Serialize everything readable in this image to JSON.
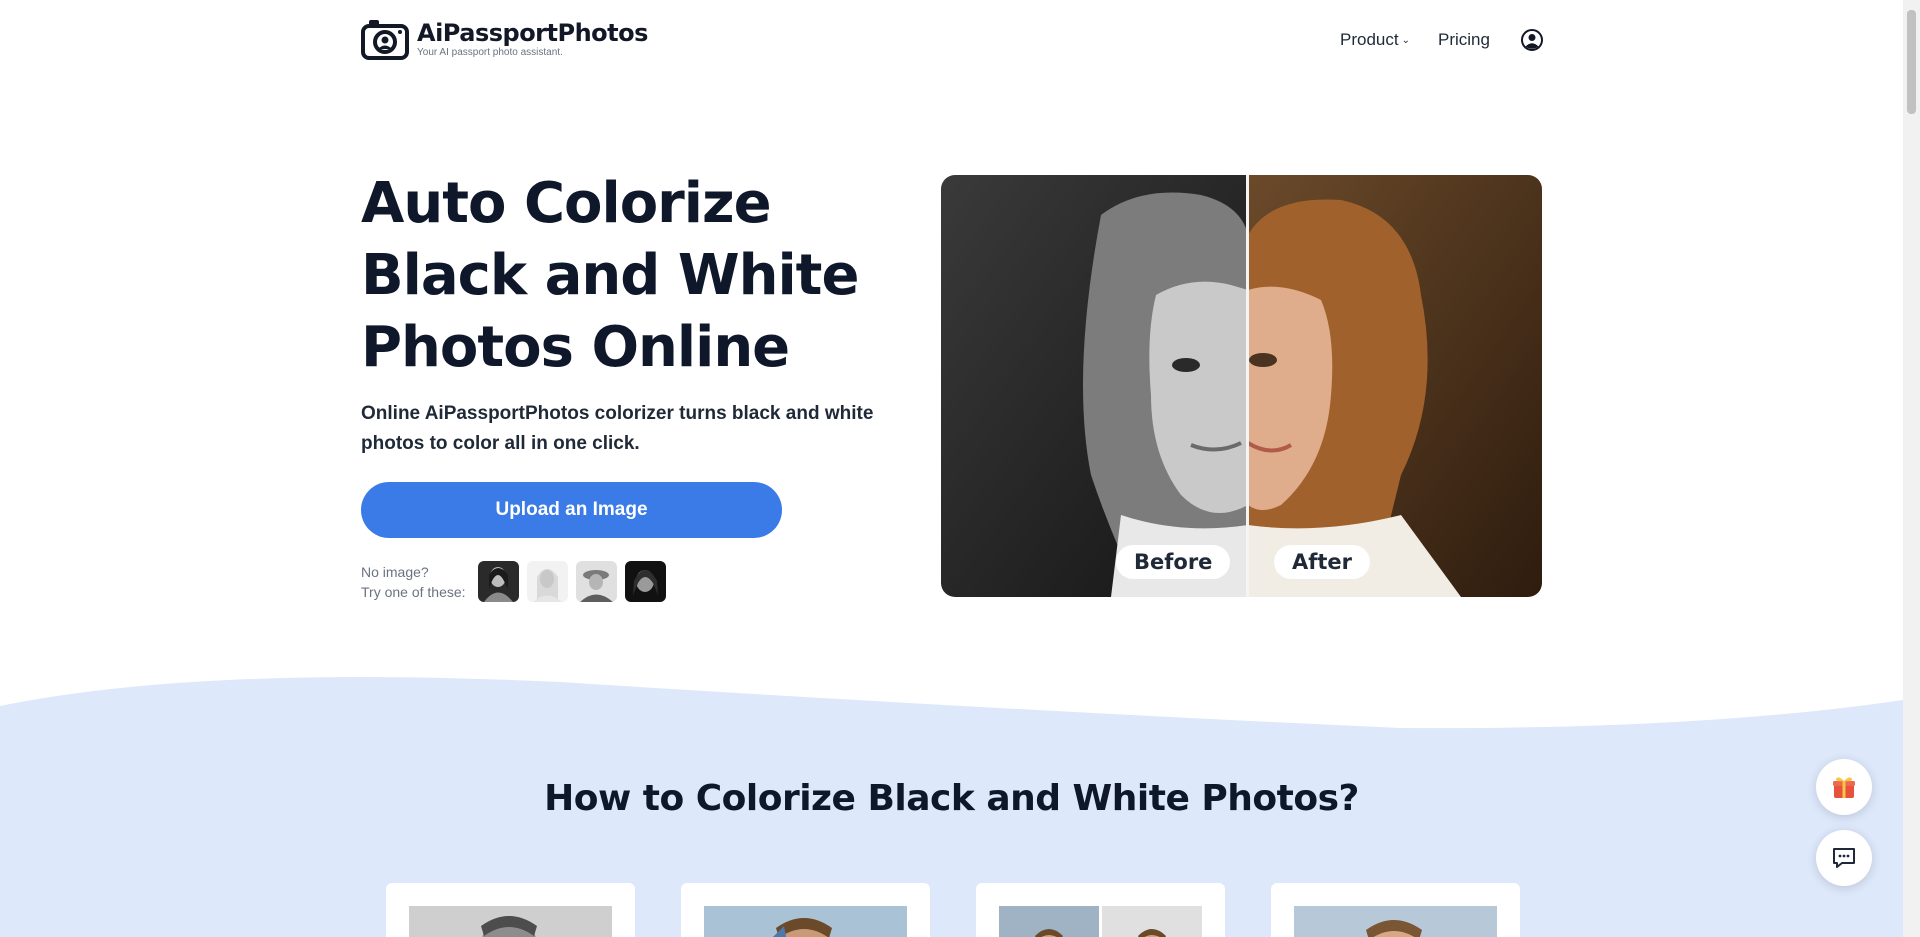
{
  "header": {
    "logo_name": "AiPassportPhotos",
    "logo_tagline": "Your AI passport photo assistant.",
    "nav": {
      "product_label": "Product",
      "pricing_label": "Pricing"
    }
  },
  "hero": {
    "title": "Auto Colorize Black and White Photos Online",
    "subtitle": "Online AiPassportPhotos colorizer turns black and white photos to color all in one click.",
    "upload_label": "Upload an Image",
    "samples_line1": "No image?",
    "samples_line2": "Try one of these:",
    "before_label": "Before",
    "after_label": "After"
  },
  "how_to": {
    "title": "How to Colorize Black and White Photos?"
  },
  "colors": {
    "accent": "#3b7be8",
    "section_bg": "#dde8fb",
    "heading": "#0f172a"
  },
  "icons": {
    "logo": "camera-icon",
    "product_dropdown": "chevron-down-icon",
    "account": "user-circle-icon",
    "gift": "gift-icon",
    "chat": "chat-icon"
  }
}
